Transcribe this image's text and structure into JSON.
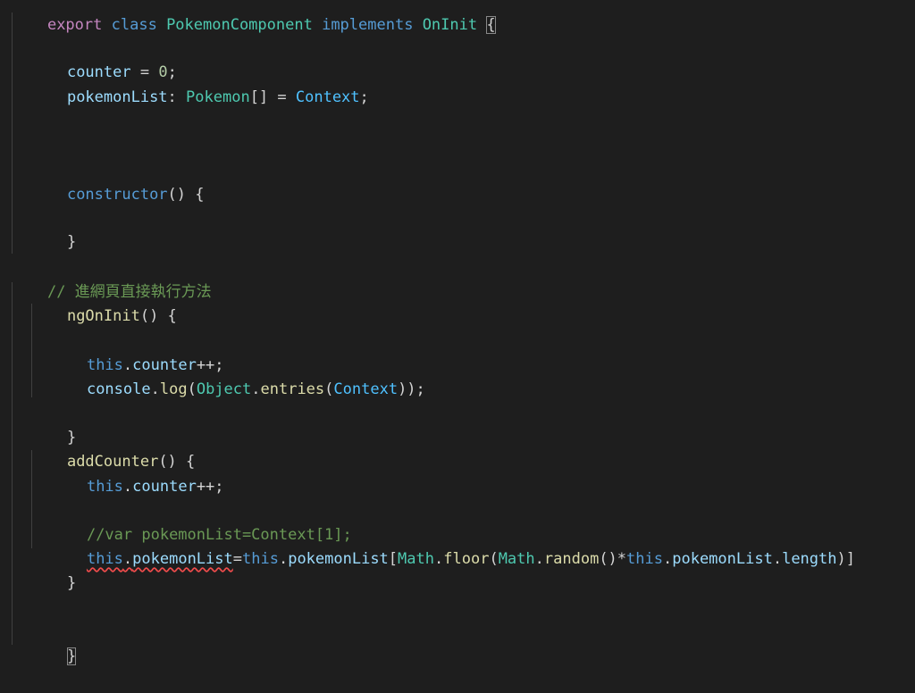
{
  "editor": {
    "lines": [
      {
        "id": "class-decl",
        "tokens": [
          "export",
          " ",
          "class",
          " ",
          "PokemonComponent",
          " ",
          "implements",
          " ",
          "OnInit",
          " ",
          "{"
        ]
      },
      {
        "id": "counter",
        "tokens": [
          "counter",
          " = ",
          "0",
          ";"
        ]
      },
      {
        "id": "pokemon-list",
        "tokens": [
          "pokemonList",
          ": ",
          "Pokemon",
          "[] = ",
          "Context",
          ";"
        ]
      },
      {
        "id": "constructor",
        "tokens": [
          "constructor",
          "() {"
        ]
      },
      {
        "id": "constructor-close",
        "tokens": [
          "}"
        ]
      },
      {
        "id": "comment-init",
        "tokens": [
          "// 進網頁直接執行方法"
        ]
      },
      {
        "id": "ngoninit",
        "tokens": [
          "ngOnInit",
          "() {"
        ]
      },
      {
        "id": "init-this-counter",
        "tokens": [
          "this",
          ".",
          "counter",
          "++;"
        ]
      },
      {
        "id": "init-console",
        "tokens": [
          "console",
          ".",
          "log",
          "(",
          "Object",
          ".",
          "entries",
          "(",
          "Context",
          "));"
        ]
      },
      {
        "id": "ngoninit-close",
        "tokens": [
          "}"
        ]
      },
      {
        "id": "addcounter",
        "tokens": [
          "addCounter",
          "() {"
        ]
      },
      {
        "id": "add-this-counter",
        "tokens": [
          "this",
          ".",
          "counter",
          "++;"
        ]
      },
      {
        "id": "comment-var",
        "tokens": [
          "//var pokemonList=Context[1];"
        ]
      },
      {
        "id": "assign-list",
        "tokens": [
          "this",
          ".",
          "pokemonList",
          "=",
          "this",
          ".",
          "pokemonList",
          "[",
          "Math",
          ".",
          "floor",
          "(",
          "Math",
          ".",
          "random",
          "()*",
          "this",
          ".",
          "pokemonList",
          ".",
          "length",
          ")]"
        ]
      },
      {
        "id": "addcounter-close",
        "tokens": [
          "}"
        ]
      },
      {
        "id": "class-close",
        "tokens": [
          "}"
        ]
      }
    ]
  }
}
